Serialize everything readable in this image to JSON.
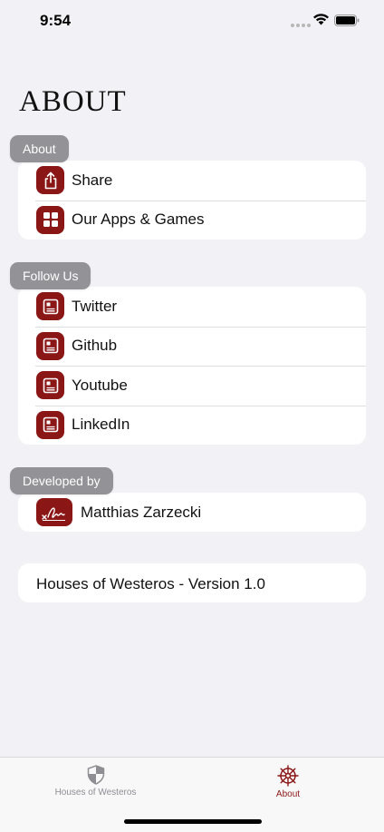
{
  "status_bar": {
    "time": "9:54"
  },
  "page": {
    "title": "ABOUT"
  },
  "sections": {
    "about": {
      "badge": "About",
      "items": [
        {
          "label": "Share",
          "icon": "share-icon"
        },
        {
          "label": "Our Apps & Games",
          "icon": "grid-icon"
        }
      ]
    },
    "follow": {
      "badge": "Follow Us",
      "items": [
        {
          "label": "Twitter",
          "icon": "profile-card-icon"
        },
        {
          "label": "Github",
          "icon": "profile-card-icon"
        },
        {
          "label": "Youtube",
          "icon": "profile-card-icon"
        },
        {
          "label": "LinkedIn",
          "icon": "profile-card-icon"
        }
      ]
    },
    "developer": {
      "badge": "Developed by",
      "name": "Matthias Zarzecki",
      "icon": "signature-icon"
    }
  },
  "version": {
    "text": "Houses of Westeros - Version 1.0"
  },
  "tab_bar": {
    "tabs": [
      {
        "label": "Houses of Westeros",
        "icon": "shield-icon",
        "selected": false
      },
      {
        "label": "About",
        "icon": "ship-wheel-icon",
        "selected": true
      }
    ]
  },
  "colors": {
    "accent": "#8b1616",
    "background": "#f2f1f6",
    "badge": "#929297",
    "tab_inactive": "#8e8e93"
  }
}
